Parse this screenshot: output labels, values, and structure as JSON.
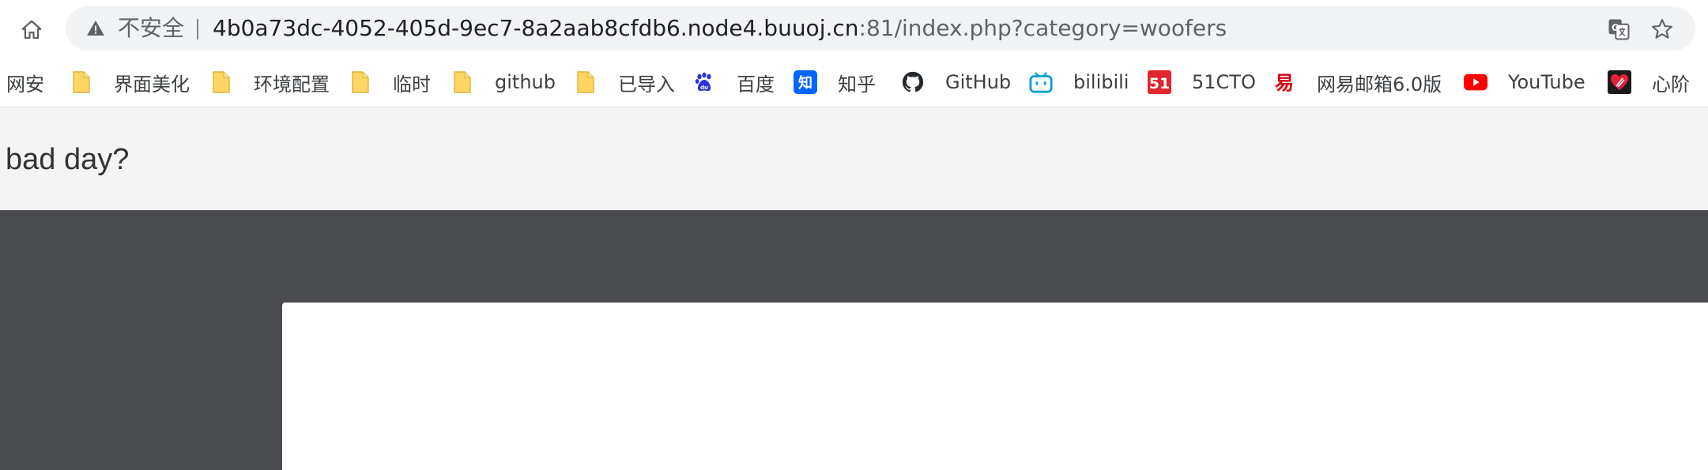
{
  "browser": {
    "security_label": "不安全",
    "url_host": "4b0a73dc-4052-405d-9ec7-8a2aab8cfdb6.node4.buuoj.cn",
    "url_rest": ":81/index.php?category=woofers"
  },
  "bookmarks": [
    {
      "label": "网安",
      "icon": "none"
    },
    {
      "label": "界面美化",
      "icon": "folder-icon"
    },
    {
      "label": "环境配置",
      "icon": "folder-icon"
    },
    {
      "label": "临时",
      "icon": "folder-icon"
    },
    {
      "label": "github",
      "icon": "folder-icon"
    },
    {
      "label": "已导入",
      "icon": "folder-icon"
    },
    {
      "label": "百度",
      "icon": "baidu-icon"
    },
    {
      "label": "知乎",
      "icon": "zhihu-icon"
    },
    {
      "label": "GitHub",
      "icon": "github-icon"
    },
    {
      "label": "bilibili",
      "icon": "bilibili-icon"
    },
    {
      "label": "51CTO",
      "icon": "51cto-icon"
    },
    {
      "label": "网易邮箱6.0版",
      "icon": "netease-icon"
    },
    {
      "label": "YouTube",
      "icon": "youtube-icon"
    },
    {
      "label": "心阶",
      "icon": "xinjie-icon"
    }
  ],
  "page": {
    "title": "bad day?"
  },
  "colors": {
    "header_bg": "#f4f4f4",
    "dark_bg": "#4a4b4f",
    "panel_bg": "#ffffff",
    "folder": "#fdd663"
  },
  "zhihu_glyph": "知",
  "cto_glyph": "51",
  "netease_glyph": "易"
}
